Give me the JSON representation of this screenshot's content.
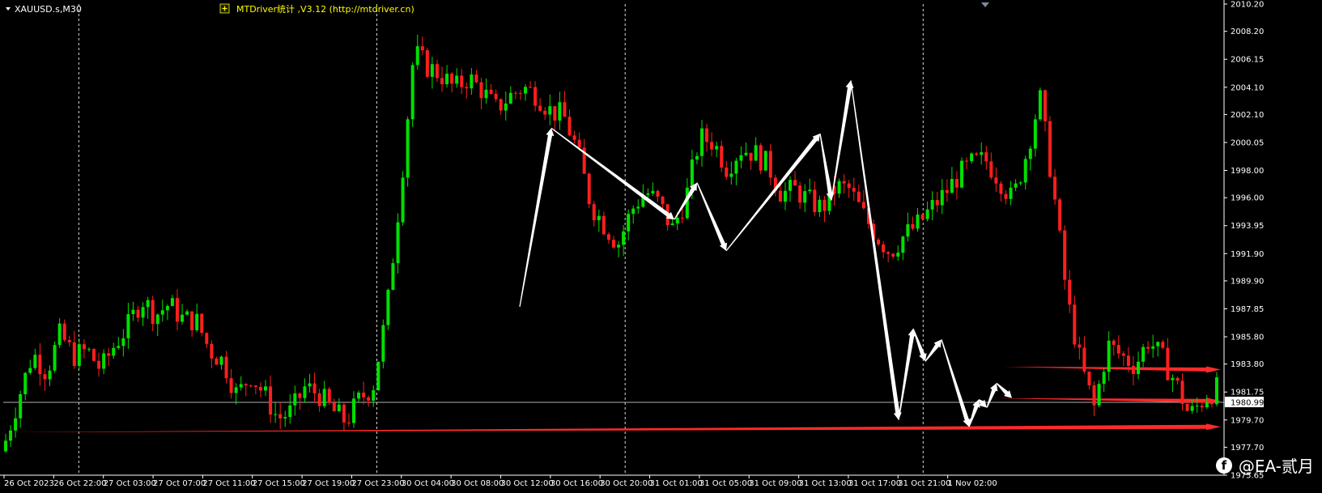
{
  "chart_header": {
    "symbol_label": "XAUUSD.s,M30",
    "indicator_label": "MTDriver统计 ,V3.12 (http://mtdriver.cn)",
    "indicator_icon": "plus-icon"
  },
  "watermark": {
    "text": "@EA-贰月",
    "icon": "facebook-icon"
  },
  "colors": {
    "background": "#000000",
    "bull": "#00e000",
    "bear": "#ff1e1e",
    "arrows": "#ffffff",
    "levels": "#ff2a2a",
    "grid": "#ffffff",
    "current_price_line": "#b0b0b0",
    "indicator_text": "#ffff00"
  },
  "chart_data": {
    "type": "candlestick",
    "symbol": "XAUUSD.s",
    "timeframe": "M30",
    "ylim": [
      1975.65,
      2010.2
    ],
    "grid": "vertical dashed at day separators",
    "price_ticks": [
      "2010.20",
      "2008.20",
      "2006.15",
      "2004.10",
      "2002.10",
      "2000.05",
      "1998.00",
      "1996.00",
      "1993.95",
      "1991.90",
      "1989.90",
      "1987.85",
      "1985.80",
      "1983.80",
      "1981.75",
      "1979.70",
      "1977.70",
      "1975.65"
    ],
    "current_price": "1980.99",
    "time_labels": [
      "26 Oct 2023",
      "26 Oct 22:00",
      "27 Oct 03:00",
      "27 Oct 07:00",
      "27 Oct 11:00",
      "27 Oct 15:00",
      "27 Oct 19:00",
      "27 Oct 23:00",
      "30 Oct 04:00",
      "30 Oct 08:00",
      "30 Oct 12:00",
      "30 Oct 16:00",
      "30 Oct 20:00",
      "31 Oct 01:00",
      "31 Oct 05:00",
      "31 Oct 09:00",
      "31 Oct 13:00",
      "31 Oct 17:00",
      "31 Oct 21:00",
      "1 Nov 02:00"
    ],
    "day_separators_after_label_index": [
      1,
      7,
      12,
      18
    ],
    "anchor_prices": [
      1978.2,
      1981.5,
      1984.6,
      1983.2,
      1986.0,
      1984.4,
      1984.8,
      1983.4,
      1985.2,
      1986.6,
      1988.6,
      1987.4,
      1988.2,
      1987.1,
      1987.0,
      1984.8,
      1984.0,
      1981.5,
      1983.0,
      1981.6,
      1979.8,
      1980.3,
      1982.1,
      1981.6,
      1980.4,
      1979.6,
      1981.2,
      1982.2,
      1987.6,
      1996.4,
      2006.7,
      2005.6,
      2005.0,
      2004.0,
      2004.8,
      2003.9,
      2002.5,
      2003.4,
      2004.1,
      2003.6,
      2002.4,
      2002.0,
      1999.5,
      1995.5,
      1994.0,
      1992.6,
      1995.1,
      1996.5,
      1995.6,
      1993.7,
      1996.0,
      2000.4,
      2000.1,
      1998.2,
      1999.6,
      1999.3,
      1998.4,
      1996.3,
      1996.6,
      1995.8,
      1995.2,
      1996.8,
      1996.6,
      1994.8,
      1993.2,
      1992.0,
      1993.2,
      1994.0,
      1995.2,
      1996.3,
      1997.6,
      1998.5,
      1998.8,
      1997.4,
      1995.8,
      1999.2,
      2003.4,
      1996.6,
      1988.6,
      1983.8,
      1980.6,
      1985.2,
      1984.4,
      1983.7,
      1985.6,
      1984.2,
      1982.4,
      1980.0,
      1981.2,
      1982.0
    ],
    "zigzag_arrows": [
      [
        1988.0,
        2001.1
      ],
      [
        2001.1,
        1994.4
      ],
      [
        1994.4,
        1997.1
      ],
      [
        1997.1,
        1992.1
      ],
      [
        1992.1,
        2000.7
      ],
      [
        2000.7,
        1995.8
      ],
      [
        1995.8,
        2004.6
      ],
      [
        2004.6,
        1979.7
      ],
      [
        1979.7,
        1986.4
      ],
      [
        1986.4,
        1984.0
      ],
      [
        1984.0,
        1985.6
      ],
      [
        1985.6,
        1979.2
      ],
      [
        1979.2,
        1981.2
      ],
      [
        1981.2,
        1980.6
      ],
      [
        1980.6,
        1982.4
      ],
      [
        1982.4,
        1981.3
      ]
    ],
    "level_lines": [
      {
        "from": 1978.8,
        "to": 1979.2
      },
      {
        "from": 1981.3,
        "to": 1981.1
      },
      {
        "from": 1983.6,
        "to": 1983.4
      }
    ]
  }
}
